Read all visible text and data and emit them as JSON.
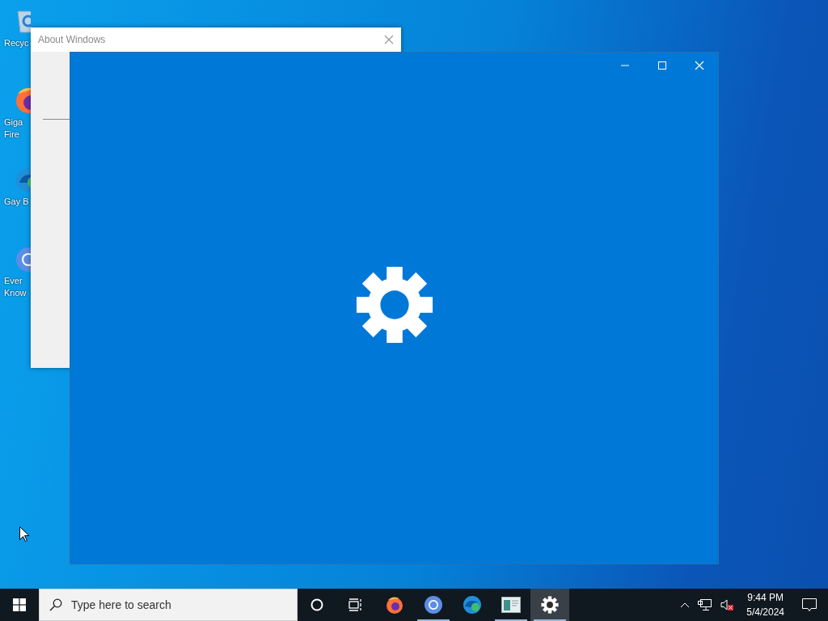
{
  "desktop_icons": [
    {
      "kind": "recycle",
      "lines": [
        "Recyc"
      ]
    },
    {
      "kind": "firefox",
      "lines": [
        "Giga",
        "Fire"
      ]
    },
    {
      "kind": "edge",
      "lines": [
        "Gay B"
      ]
    },
    {
      "kind": "chrome",
      "lines": [
        "Ever",
        "Know"
      ]
    }
  ],
  "about_window": {
    "title": "About Windows"
  },
  "taskbar": {
    "search": {
      "placeholder": "Type here to search"
    },
    "apps": [
      {
        "kind": "cortana",
        "running": false,
        "selected": false
      },
      {
        "kind": "taskview",
        "running": false,
        "selected": false
      },
      {
        "kind": "firefox",
        "running": false,
        "selected": false
      },
      {
        "kind": "chrome",
        "running": true,
        "selected": false
      },
      {
        "kind": "edge",
        "running": false,
        "selected": false
      },
      {
        "kind": "app",
        "running": true,
        "selected": false
      },
      {
        "kind": "settings",
        "running": true,
        "selected": true
      }
    ],
    "volume_muted": true,
    "clock": {
      "time": "9:44 PM",
      "date": "5/4/2024"
    }
  }
}
